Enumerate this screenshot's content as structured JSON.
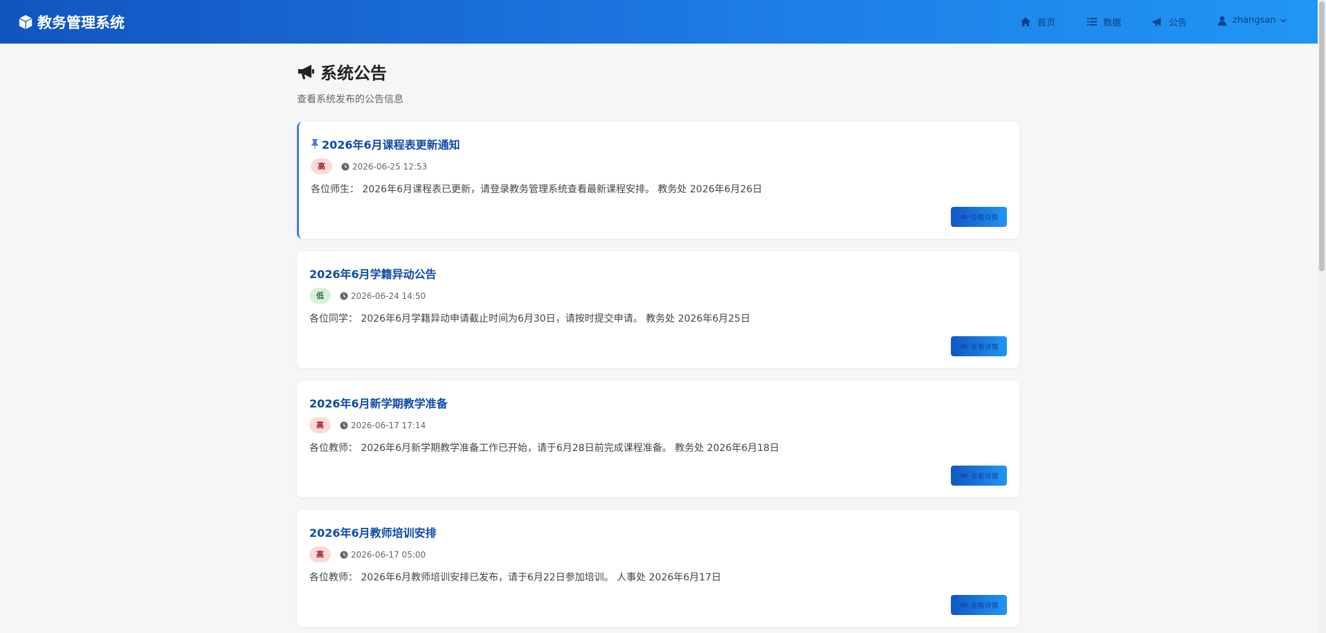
{
  "brand": {
    "title": "教务管理系统",
    "icon": "cube-icon"
  },
  "nav": {
    "home": "首页",
    "data": "数据",
    "notice": "公告",
    "user": "zhangsan"
  },
  "page": {
    "title": "系统公告",
    "subtitle": "查看系统发布的公告信息"
  },
  "detail_label": "查看详情",
  "announcements": [
    {
      "title": "2026年6月课程表更新通知",
      "pinned": true,
      "priority": "高",
      "date": "2026-06-25 12:53",
      "content": "各位师生： 2026年6月课程表已更新，请登录教务管理系统查看最新课程安排。 教务处 2026年6月26日"
    },
    {
      "title": "2026年6月学籍异动公告",
      "pinned": false,
      "priority": "低",
      "date": "2026-06-24 14:50",
      "content": "各位同学： 2026年6月学籍异动申请截止时间为6月30日，请按时提交申请。 教务处 2026年6月25日"
    },
    {
      "title": "2026年6月新学期教学准备",
      "pinned": false,
      "priority": "高",
      "date": "2026-06-17 17:14",
      "content": "各位教师： 2026年6月新学期教学准备工作已开始，请于6月28日前完成课程准备。 教务处 2026年6月18日"
    },
    {
      "title": "2026年6月教师培训安排",
      "pinned": false,
      "priority": "高",
      "date": "2026-06-17 05:00",
      "content": "各位教师： 2026年6月教师培训安排已发布，请于6月22日参加培训。 人事处 2026年6月17日"
    }
  ],
  "colors": {
    "nav_gradient_start": "#1254c0",
    "nav_gradient_end": "#2196f3",
    "title_blue": "#0d4aa8",
    "high_badge_bg": "#fadada",
    "low_badge_bg": "#d7f0dc"
  }
}
